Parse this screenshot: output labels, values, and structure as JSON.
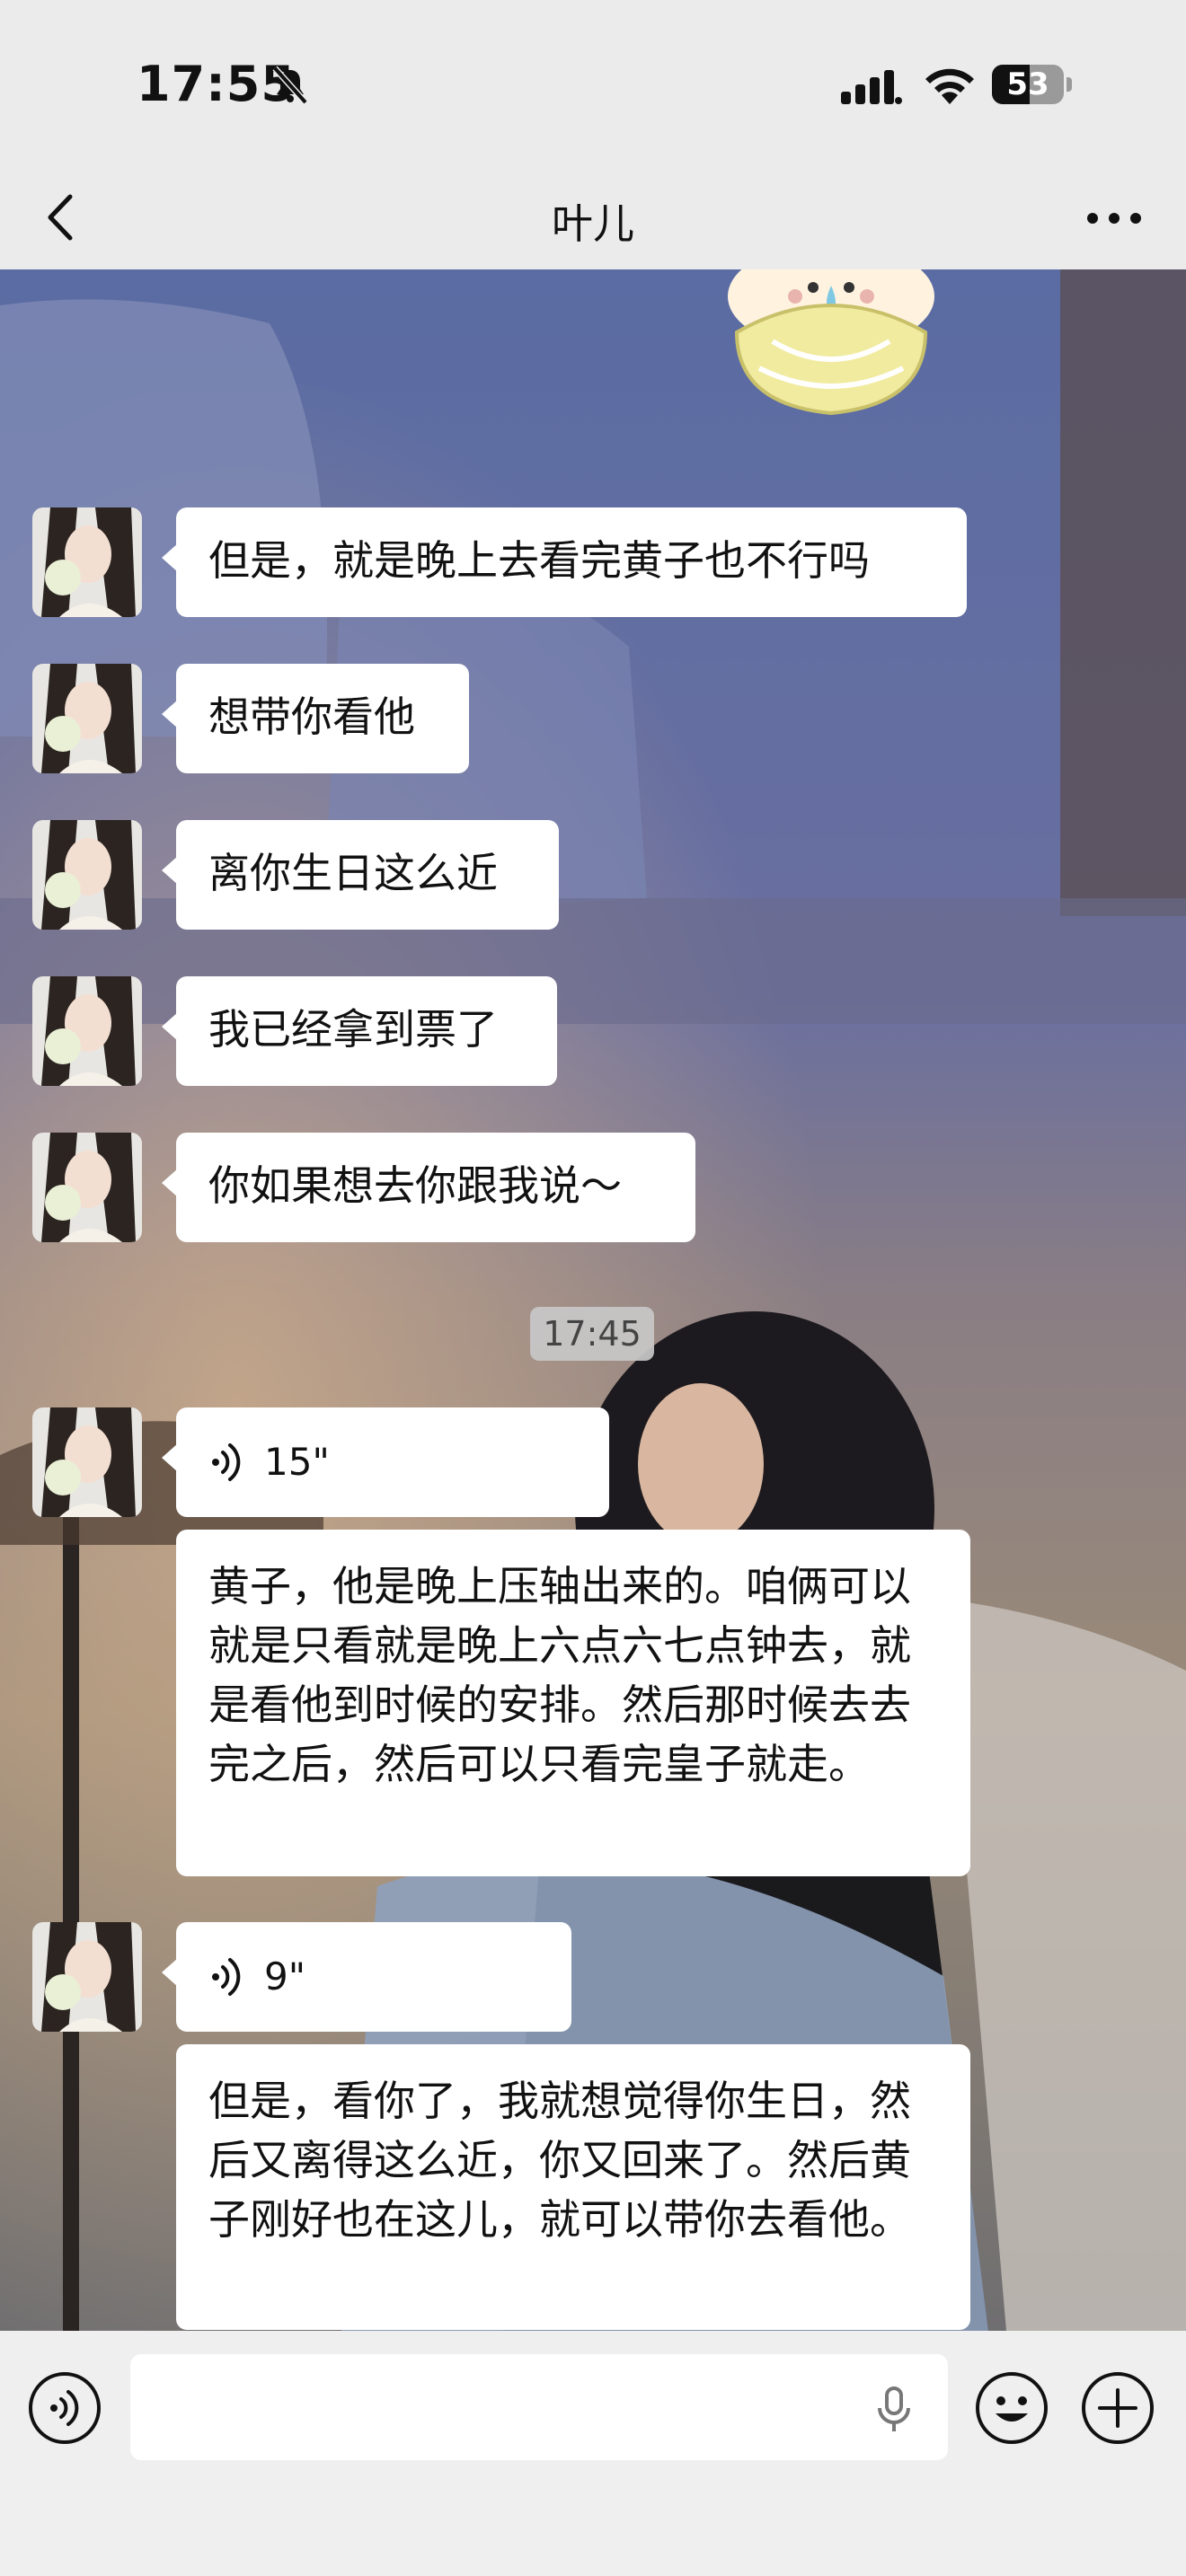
{
  "status": {
    "time": "17:55",
    "battery": "53",
    "battery_level": 0.53
  },
  "nav": {
    "title": "叶儿"
  },
  "messages": [
    {
      "text": "但是，就是晚上去看完黄子也不行吗"
    },
    {
      "text": "想带你看他"
    },
    {
      "text": "离你生日这么近"
    },
    {
      "text": "我已经拿到票了"
    },
    {
      "text": "你如果想去你跟我说～"
    }
  ],
  "timestamp": "17:45",
  "voice1": {
    "duration": "15\"",
    "transcript": "黄子，他是晚上压轴出来的。咱俩可以就是只看就是晚上六点六七点钟去，就是看他到时候的安排。然后那时候去去完之后，然后可以只看完皇子就走。"
  },
  "voice2": {
    "duration": "9\"",
    "transcript": "但是，看你了，我就想觉得你生日，然后又离得这么近，你又回来了。然后黄子刚好也在这儿，就可以带你去看他。"
  },
  "colors": {
    "bubble": "#ffffff",
    "input_bar": "#efefef",
    "nav_bar": "#ebebeb"
  }
}
